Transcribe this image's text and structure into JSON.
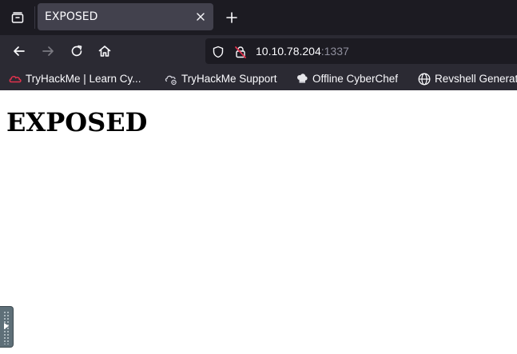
{
  "tab": {
    "title": "EXPOSED",
    "close_icon": "close-icon"
  },
  "address": {
    "host": "10.10.78.204",
    "port": ":1337"
  },
  "bookmarks": [
    {
      "label": "TryHackMe | Learn Cy...",
      "icon": "tryhackme-icon"
    },
    {
      "label": "TryHackMe Support",
      "icon": "cloud-settings-icon"
    },
    {
      "label": "Offline CyberChef",
      "icon": "chef-hat-icon"
    },
    {
      "label": "Revshell Generator",
      "icon": "globe-icon"
    }
  ],
  "page": {
    "heading": "EXPOSED"
  },
  "colors": {
    "tab_bg": "#42414d",
    "toolbar_bg": "#2b2a33",
    "tabstrip_bg": "#1c1b22",
    "accent_red": "#e0324d"
  }
}
